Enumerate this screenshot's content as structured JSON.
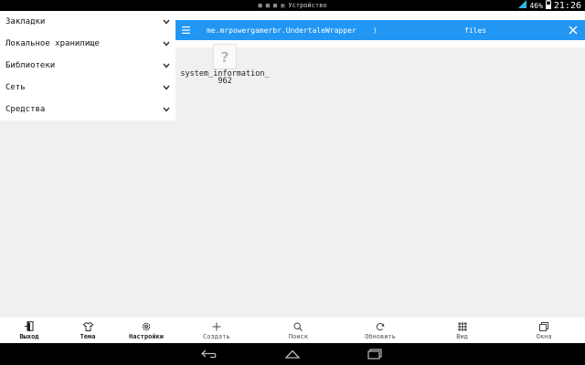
{
  "status_bar": {
    "title": "Устройство",
    "battery_pct": "46%",
    "time": "21:26"
  },
  "drawer": {
    "items": [
      {
        "label": "Закладки"
      },
      {
        "label": "Локальное хранилище"
      },
      {
        "label": "Библиотеки"
      },
      {
        "label": "Сеть"
      },
      {
        "label": "Средства"
      }
    ]
  },
  "toolbar": {
    "path": "me.mrpowergamerbr.UndertaleWrapper",
    "separator": "⟩",
    "current": "files"
  },
  "files": [
    {
      "name_line1": "system_information_",
      "name_line2": "962",
      "icon": "unknown-file-icon"
    }
  ],
  "drawer_bottom": [
    {
      "label": "Выход",
      "icon": "exit-icon"
    },
    {
      "label": "Тема",
      "icon": "shirt-icon"
    },
    {
      "label": "Настройки",
      "icon": "gear-icon"
    }
  ],
  "actions": [
    {
      "label": "Создать",
      "icon": "plus-icon"
    },
    {
      "label": "Поиск",
      "icon": "search-icon"
    },
    {
      "label": "Обновить",
      "icon": "refresh-icon"
    },
    {
      "label": "Вид",
      "icon": "grid-icon"
    },
    {
      "label": "Окна",
      "icon": "windows-icon"
    }
  ],
  "colors": {
    "accent": "#2196f3",
    "panel_bg": "#f0f0f0"
  }
}
